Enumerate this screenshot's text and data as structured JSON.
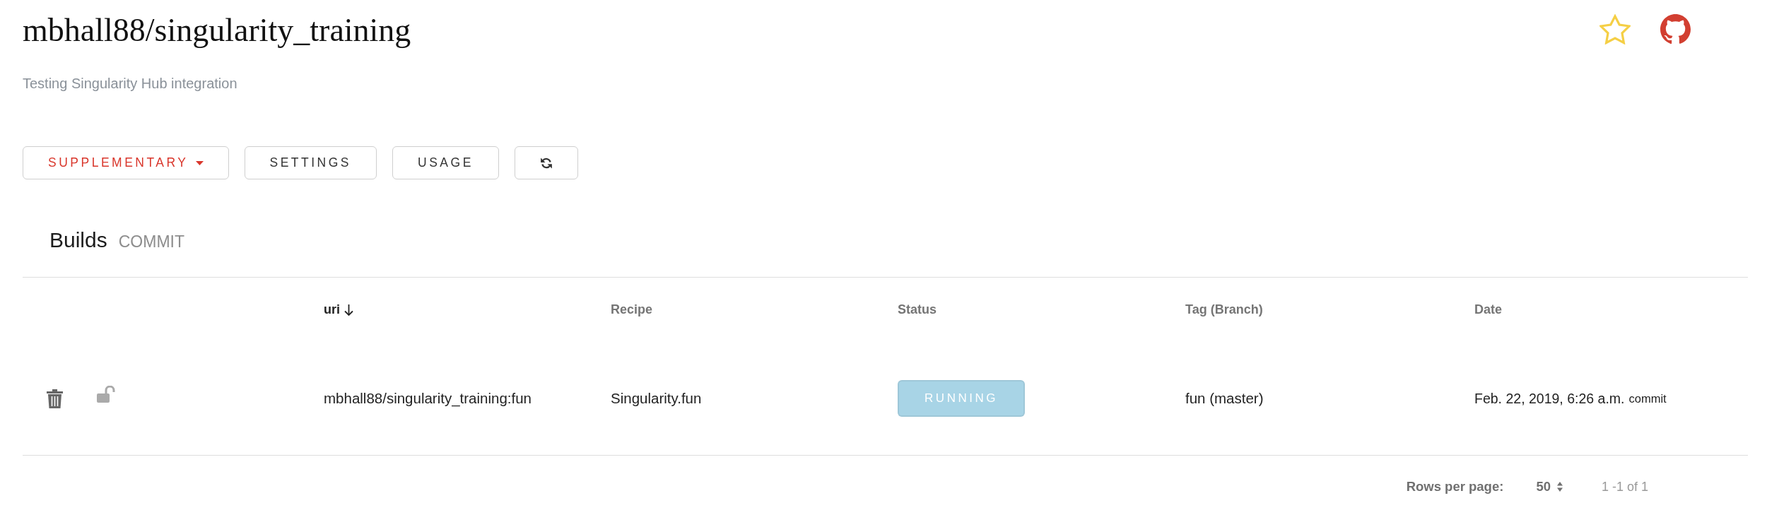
{
  "repo": {
    "title": "mbhall88/singularity_training",
    "description": "Testing Singularity Hub integration",
    "starred": false
  },
  "toolbar": {
    "buttons": [
      {
        "kind": "dropdown",
        "label": "SUPPLEMENTARY"
      },
      {
        "kind": "text",
        "label": "SETTINGS"
      },
      {
        "kind": "text",
        "label": "USAGE"
      },
      {
        "kind": "refresh"
      }
    ]
  },
  "builds": {
    "title": "Builds",
    "subtitle": "COMMIT",
    "columns": [
      {
        "label": "uri",
        "sorted": true
      },
      {
        "label": "Recipe",
        "sorted": false
      },
      {
        "label": "Status",
        "sorted": false
      },
      {
        "label": "Tag (Branch)",
        "sorted": false
      },
      {
        "label": "Date",
        "sorted": false
      }
    ],
    "rows": [
      {
        "locked": false,
        "uri": "mbhall88/singularity_training:fun",
        "recipe": "Singularity.fun",
        "status": {
          "label": "RUNNING",
          "color": "#a8d4e6"
        },
        "tag": "fun (master)",
        "date": "Feb. 22, 2019, 6:26 a.m.",
        "date_link": "commit"
      }
    ],
    "pagination": {
      "rows_per_page_label": "Rows per page:",
      "rows_per_page": "50",
      "range": "1 -1 of 1"
    }
  }
}
